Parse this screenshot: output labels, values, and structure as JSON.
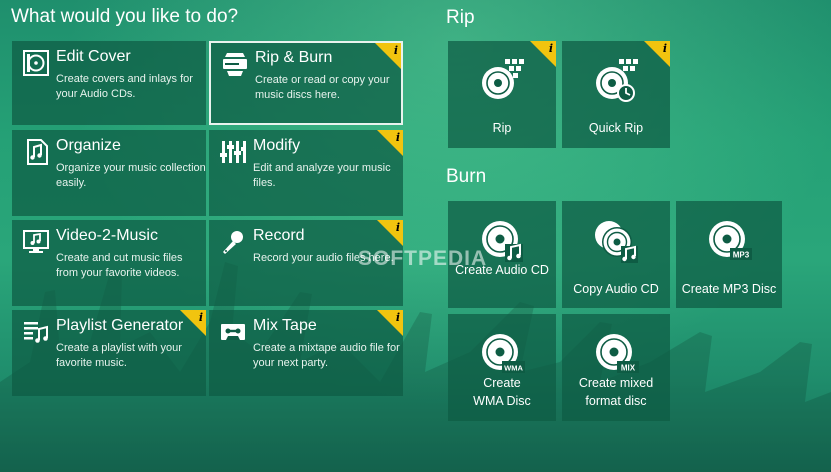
{
  "main": {
    "heading": "What would you like to do?",
    "tiles": [
      {
        "title": "Edit Cover",
        "desc": "Create covers and inlays for your Audio CDs.",
        "icon": "edit-cover-icon",
        "info": false
      },
      {
        "title": "Rip & Burn",
        "desc": "Create or read or copy your music discs here.",
        "icon": "rip-burn-icon",
        "info": true,
        "selected": true
      },
      {
        "title": "Organize",
        "desc": "Organize your music collection easily.",
        "icon": "organize-icon",
        "info": false
      },
      {
        "title": "Modify",
        "desc": "Edit and analyze your music files.",
        "icon": "equalizer-icon",
        "info": true
      },
      {
        "title": "Video-2-Music",
        "desc": "Create and cut music files from your favorite videos.",
        "icon": "video-music-icon",
        "info": false
      },
      {
        "title": "Record",
        "desc": "Record your audio files here.",
        "icon": "microphone-icon",
        "info": true
      },
      {
        "title": "Playlist Generator",
        "desc": "Create a playlist with your favorite music.",
        "icon": "playlist-icon",
        "info": true
      },
      {
        "title": "Mix Tape",
        "desc": "Create a mixtape audio file for your next party.",
        "icon": "cassette-icon",
        "info": true
      }
    ]
  },
  "rip": {
    "heading": "Rip",
    "items": [
      {
        "label": "Rip",
        "icon": "rip-disc-icon",
        "info": true
      },
      {
        "label": "Quick Rip",
        "icon": "quick-rip-icon",
        "info": true
      }
    ]
  },
  "burn": {
    "heading": "Burn",
    "items": [
      {
        "label": "Create Audio CD",
        "icon": "audio-cd-icon"
      },
      {
        "label": "Copy Audio CD",
        "icon": "copy-cd-icon"
      },
      {
        "label": "Create MP3 Disc",
        "icon": "mp3-disc-icon",
        "disc_text": "MP3"
      },
      {
        "label": "Create WMA Disc",
        "icon": "wma-disc-icon",
        "disc_text": "WMA"
      },
      {
        "label": "Create mixed format disc",
        "icon": "mix-disc-icon",
        "disc_text": "MIX"
      }
    ]
  },
  "badge_letter": "i",
  "watermark": "SOFTPEDIA",
  "colors": {
    "badge": "#f1c40f",
    "tile": "#0e5c44",
    "background": "#25a176",
    "selected_border": "#e9f3ee"
  }
}
